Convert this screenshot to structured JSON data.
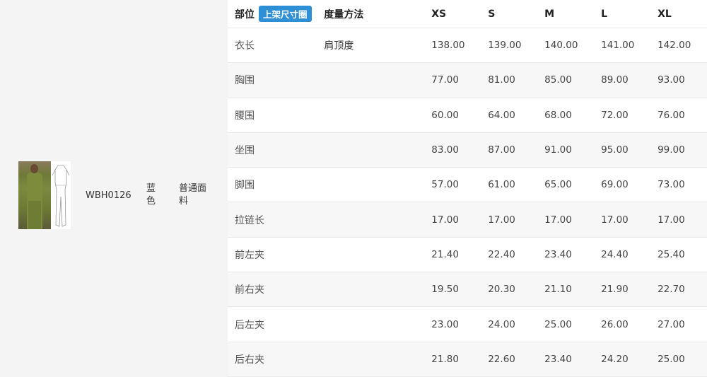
{
  "product": {
    "code": "WBH0126",
    "color": "蓝色",
    "fabric": "普通面料"
  },
  "table": {
    "header": {
      "part": "部位",
      "tag": "上架尺寸圈",
      "method": "度量方法",
      "sizes": [
        "XS",
        "S",
        "M",
        "L",
        "XL"
      ]
    },
    "rows": [
      {
        "part": "衣长",
        "method": "肩顶度",
        "values": [
          "138.00",
          "139.00",
          "140.00",
          "141.00",
          "142.00"
        ]
      },
      {
        "part": "胸围",
        "method": "",
        "values": [
          "77.00",
          "81.00",
          "85.00",
          "89.00",
          "93.00"
        ]
      },
      {
        "part": "腰围",
        "method": "",
        "values": [
          "60.00",
          "64.00",
          "68.00",
          "72.00",
          "76.00"
        ]
      },
      {
        "part": "坐围",
        "method": "",
        "values": [
          "83.00",
          "87.00",
          "91.00",
          "95.00",
          "99.00"
        ]
      },
      {
        "part": "脚围",
        "method": "",
        "values": [
          "57.00",
          "61.00",
          "65.00",
          "69.00",
          "73.00"
        ]
      },
      {
        "part": "拉链长",
        "method": "",
        "values": [
          "17.00",
          "17.00",
          "17.00",
          "17.00",
          "17.00"
        ]
      },
      {
        "part": "前左夹",
        "method": "",
        "values": [
          "21.40",
          "22.40",
          "23.40",
          "24.40",
          "25.40"
        ]
      },
      {
        "part": "前右夹",
        "method": "",
        "values": [
          "19.50",
          "20.30",
          "21.10",
          "21.90",
          "22.70"
        ]
      },
      {
        "part": "后左夹",
        "method": "",
        "values": [
          "23.00",
          "24.00",
          "25.00",
          "26.00",
          "27.00"
        ]
      },
      {
        "part": "后右夹",
        "method": "",
        "values": [
          "21.80",
          "22.60",
          "23.40",
          "24.20",
          "25.00"
        ]
      }
    ]
  }
}
